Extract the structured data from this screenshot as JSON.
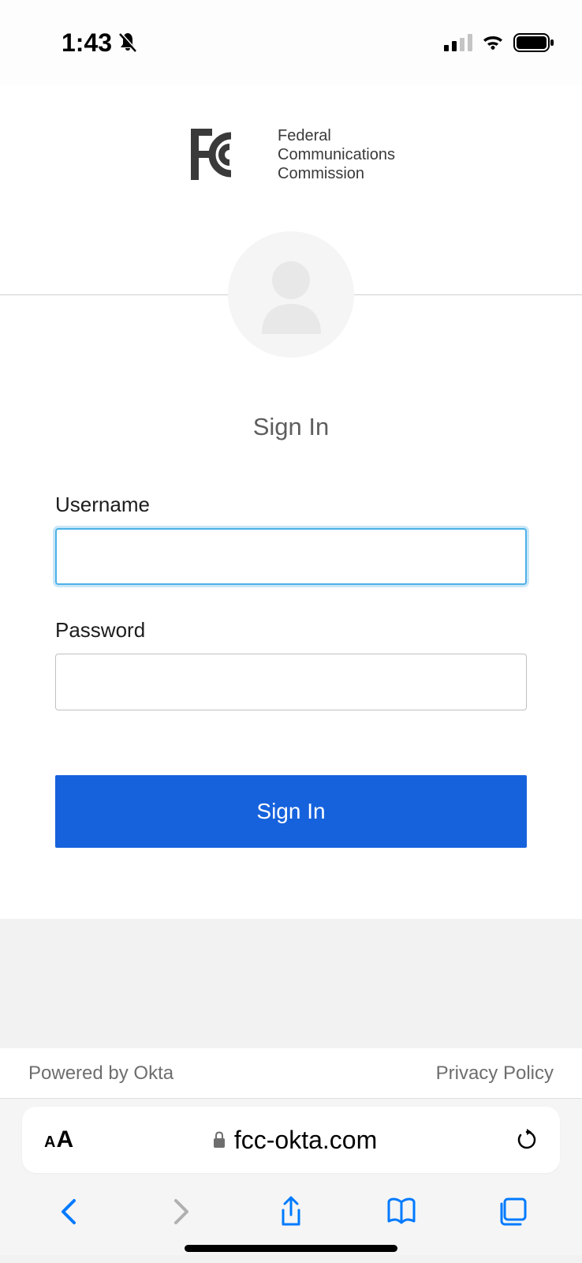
{
  "status_bar": {
    "time": "1:43"
  },
  "logo": {
    "line1": "Federal",
    "line2": "Communications",
    "line3": "Commission"
  },
  "form": {
    "title": "Sign In",
    "username_label": "Username",
    "username_value": "",
    "password_label": "Password",
    "password_value": "",
    "submit_label": "Sign In"
  },
  "footer": {
    "powered_by": "Powered by Okta",
    "privacy_link": "Privacy Policy"
  },
  "browser": {
    "url": "fcc-okta.com"
  }
}
